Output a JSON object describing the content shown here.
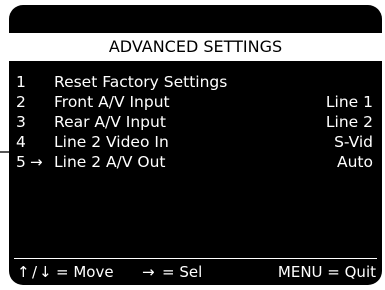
{
  "screen": {
    "title": "ADVANCED SETTINGS",
    "items": [
      {
        "number": "1",
        "label": "Reset Factory Settings",
        "value": "",
        "selected": false
      },
      {
        "number": "2",
        "label": "Front A/V Input",
        "value": "Line 1",
        "selected": false
      },
      {
        "number": "3",
        "label": "Rear A/V Input",
        "value": "Line 2",
        "selected": false
      },
      {
        "number": "4",
        "label": "Line 2 Video In",
        "value": "S-Vid",
        "selected": false
      },
      {
        "number": "5",
        "label": "Line 2 A/V Out",
        "value": "Auto",
        "selected": true
      }
    ],
    "selection_marker": "→",
    "hints": {
      "up_icon": "↑",
      "slash": "/",
      "down_icon": "↓",
      "move_text": "= Move",
      "sel_icon": "→",
      "sel_text": "= Sel",
      "quit_text": "MENU = Quit"
    }
  },
  "colors": {
    "background": "#000000",
    "text": "#ffffff",
    "title_bar_background": "#ffffff",
    "title_bar_text": "#000000"
  }
}
